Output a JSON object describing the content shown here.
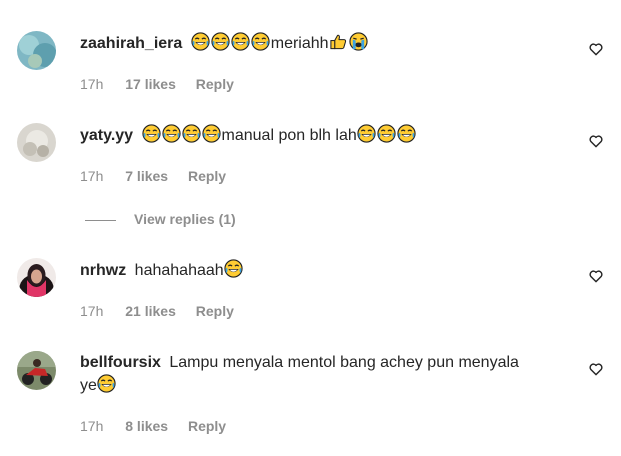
{
  "comments": [
    {
      "username": "zaahirah_iera",
      "text": "meriahh",
      "time": "17h",
      "likes": "17 likes",
      "reply": "Reply",
      "avatar_icon": "avatar-teal-blur"
    },
    {
      "username": "yaty.yy",
      "text": "manual pon blh lah",
      "time": "17h",
      "likes": "7 likes",
      "reply": "Reply",
      "avatar_icon": "avatar-grey-light"
    },
    {
      "username": "nrhwz",
      "text": "hahahahaah",
      "time": "17h",
      "likes": "21 likes",
      "reply": "Reply",
      "avatar_icon": "avatar-dark-hijab"
    },
    {
      "username": "bellfoursix",
      "text_line1": "Lampu menyala mentol bang achey pun menyala",
      "text_line2": "ye",
      "time": "17h",
      "likes": "8 likes",
      "reply": "Reply",
      "avatar_icon": "avatar-motorbike"
    }
  ],
  "view_replies": "View replies (1)",
  "icons": {
    "emoji_laugh": "face-with-tears-of-joy-icon",
    "emoji_thumbs": "thumbs-up-icon",
    "emoji_cry": "loudly-crying-face-icon",
    "like": "heart-outline-icon"
  },
  "colors": {
    "text": "#262626",
    "secondary": "#8e8e8e",
    "emoji_yellow": "#ffcc33"
  }
}
